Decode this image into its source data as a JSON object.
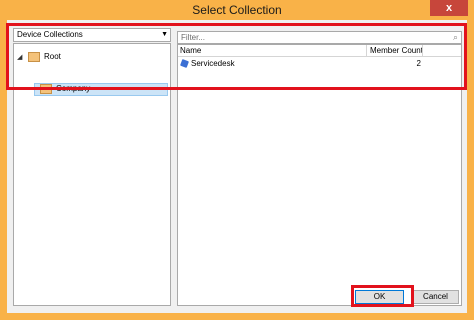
{
  "window": {
    "title": "Select Collection",
    "close_glyph": "x"
  },
  "collection_type": {
    "selected": "Device Collections"
  },
  "tree": {
    "nodes": [
      {
        "label": "Root",
        "expanded": true
      },
      {
        "label": "Company",
        "selected": true
      }
    ]
  },
  "filter": {
    "placeholder": "Filter..."
  },
  "list": {
    "columns": [
      "Name",
      "Member Count"
    ],
    "rows": [
      {
        "name": "Servicedesk",
        "member_count": "2"
      }
    ]
  },
  "buttons": {
    "ok": "OK",
    "cancel": "Cancel"
  },
  "colors": {
    "title_bar": "#f9b248",
    "close_button": "#c7463b",
    "highlight_frame": "#e2121c",
    "selection": "#cce4f7"
  }
}
